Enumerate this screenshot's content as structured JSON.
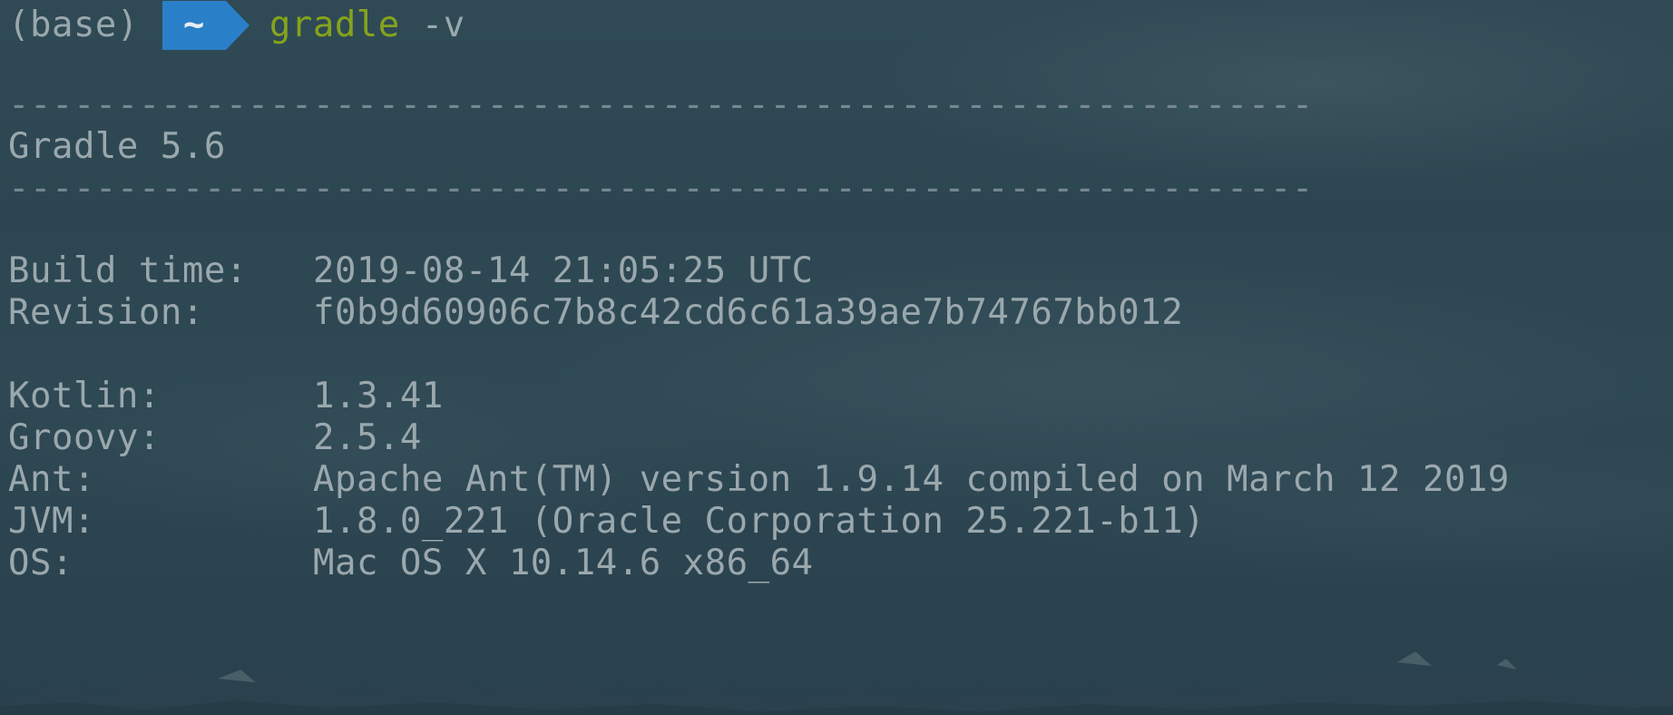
{
  "prompt": {
    "env": "(base)",
    "dir": "~",
    "command": "gradle",
    "flag": "-v"
  },
  "separator": "------------------------------------------------------------",
  "title": "Gradle 5.6",
  "build": [
    {
      "key": "Build time:",
      "value": "2019-08-14 21:05:25 UTC"
    },
    {
      "key": "Revision:",
      "value": "f0b9d60906c7b8c42cd6c61a39ae7b74767bb012"
    }
  ],
  "versions": [
    {
      "key": "Kotlin:",
      "value": "1.3.41"
    },
    {
      "key": "Groovy:",
      "value": "2.5.4"
    },
    {
      "key": "Ant:",
      "value": "Apache Ant(TM) version 1.9.14 compiled on March 12 2019"
    },
    {
      "key": "JVM:",
      "value": "1.8.0_221 (Oracle Corporation 25.221-b11)"
    },
    {
      "key": "OS:",
      "value": "Mac OS X 10.14.6 x86_64"
    }
  ],
  "colors": {
    "accent": "#2a80c8",
    "command": "#86a31c",
    "text": "#9aa8ad"
  }
}
